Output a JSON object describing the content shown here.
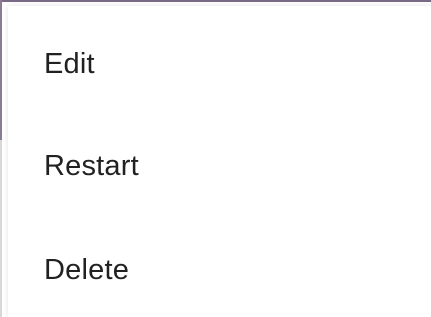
{
  "menu": {
    "items": [
      {
        "label": "Edit"
      },
      {
        "label": "Restart"
      },
      {
        "label": "Delete"
      }
    ]
  },
  "colors": {
    "text": "#212121",
    "menu_background": "#ffffff",
    "underlying_window_edge": "#7a6a86"
  }
}
